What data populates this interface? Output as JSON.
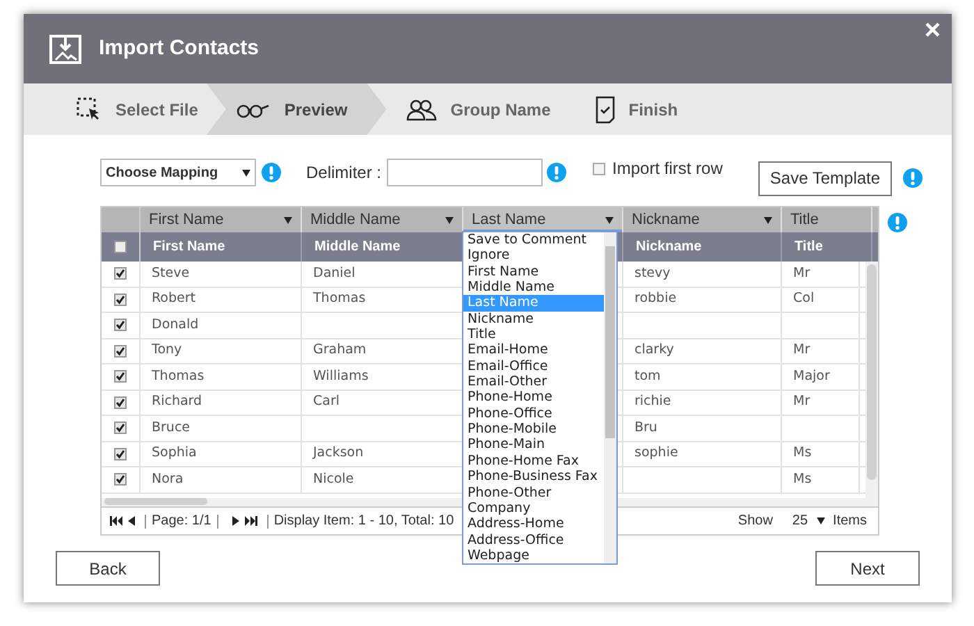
{
  "window": {
    "title": "Import Contacts",
    "close": "×"
  },
  "steps": [
    {
      "label": "Select File",
      "selected": false
    },
    {
      "label": "Preview",
      "selected": true
    },
    {
      "label": "Group Name",
      "selected": false
    },
    {
      "label": "Finish",
      "selected": false
    }
  ],
  "mapping": {
    "value": "Choose Mapping"
  },
  "delimiter": {
    "label": "Delimiter :"
  },
  "import_first_row": {
    "label": "Import first row",
    "checked": false
  },
  "save_template": "Save Template",
  "table": {
    "select_all": false,
    "columns": [
      {
        "mapping": "First Name",
        "name": "First Name",
        "expanded": false
      },
      {
        "mapping": "Middle Name",
        "name": "Middle Name",
        "expanded": false
      },
      {
        "mapping": "Last Name",
        "expanded": true
      },
      {
        "mapping": "Nickname",
        "name": "Nickname",
        "expanded": false
      },
      {
        "mapping": "Title",
        "name": "Title",
        "expanded": false
      }
    ],
    "rows": [
      {
        "checked": true,
        "cells": [
          "Steve",
          "Daniel",
          "",
          "stevy",
          "Mr"
        ]
      },
      {
        "checked": true,
        "cells": [
          "Robert",
          "Thomas",
          "",
          "robbie",
          "Col"
        ]
      },
      {
        "checked": true,
        "cells": [
          "Donald",
          "",
          "",
          "",
          ""
        ]
      },
      {
        "checked": true,
        "cells": [
          "Tony",
          "Graham",
          "",
          "clarky",
          "Mr"
        ]
      },
      {
        "checked": true,
        "cells": [
          "Thomas",
          "Williams",
          "",
          "tom",
          "Major"
        ]
      },
      {
        "checked": true,
        "cells": [
          "Richard",
          "Carl",
          "",
          "richie",
          "Mr"
        ]
      },
      {
        "checked": true,
        "cells": [
          "Bruce",
          "",
          "",
          "Bru",
          ""
        ]
      },
      {
        "checked": true,
        "cells": [
          "Sophia",
          "Jackson",
          "",
          "sophie",
          "Ms"
        ]
      },
      {
        "checked": true,
        "cells": [
          "Nora",
          "Nicole",
          "",
          "",
          "Ms"
        ]
      }
    ]
  },
  "pager": {
    "page": "Page: 1/1",
    "display": "Display Item: 1 - 10, Total: 10",
    "show": "Show",
    "page_size": "25",
    "items": "Items"
  },
  "mapping_list": {
    "options": [
      {
        "label": "Save to Comment",
        "selected": false
      },
      {
        "label": "Ignore",
        "selected": false
      },
      {
        "label": "First Name",
        "selected": false
      },
      {
        "label": "Middle Name",
        "selected": false
      },
      {
        "label": "Last Name",
        "selected": true
      },
      {
        "label": "Nickname",
        "selected": false
      },
      {
        "label": "Title",
        "selected": false
      },
      {
        "label": "Email-Home",
        "selected": false
      },
      {
        "label": "Email-Office",
        "selected": false
      },
      {
        "label": "Email-Other",
        "selected": false
      },
      {
        "label": "Phone-Home",
        "selected": false
      },
      {
        "label": "Phone-Office",
        "selected": false
      },
      {
        "label": "Phone-Mobile",
        "selected": false
      },
      {
        "label": "Phone-Main",
        "selected": false
      },
      {
        "label": "Phone-Home Fax",
        "selected": false
      },
      {
        "label": "Phone-Business Fax",
        "selected": false
      },
      {
        "label": "Phone-Other",
        "selected": false
      },
      {
        "label": "Company",
        "selected": false
      },
      {
        "label": "Address-Home",
        "selected": false
      },
      {
        "label": "Address-Office",
        "selected": false
      },
      {
        "label": "Webpage",
        "selected": false
      }
    ]
  },
  "buttons": {
    "back": "Back",
    "next": "Next"
  }
}
